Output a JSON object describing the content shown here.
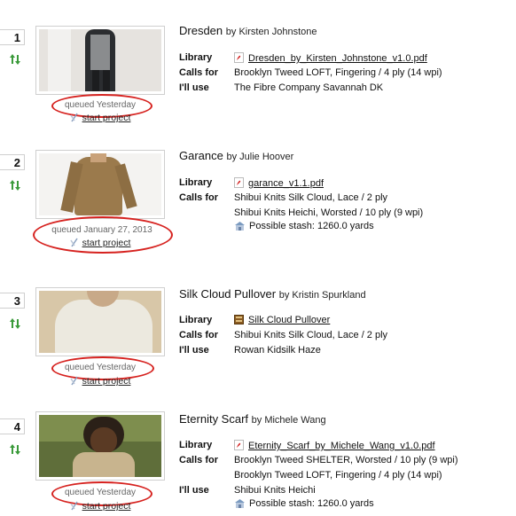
{
  "entries": [
    {
      "rank": "1",
      "title": "Dresden",
      "by": "by Kirsten Johnstone",
      "queued": "queued Yesterday",
      "start_label": "start project",
      "library_label": "Library",
      "library_value": "Dresden_by_Kirsten_Johnstone_v1.0.pdf",
      "calls_for_label": "Calls for",
      "calls_for": [
        "Brooklyn Tweed LOFT, Fingering / 4 ply (14 wpi)"
      ],
      "ill_use_label": "I'll use",
      "ill_use": "The Fibre Company Savannah DK"
    },
    {
      "rank": "2",
      "title": "Garance",
      "by": "by Julie Hoover",
      "queued": "queued January 27, 2013",
      "start_label": "start project",
      "library_label": "Library",
      "library_value": "garance_v1.1.pdf",
      "calls_for_label": "Calls for",
      "calls_for": [
        "Shibui Knits Silk Cloud, Lace / 2 ply",
        "Shibui Knits Heichi, Worsted / 10 ply (9 wpi)"
      ],
      "stash": "Possible stash: 1260.0 yards"
    },
    {
      "rank": "3",
      "title": "Silk Cloud Pullover",
      "by": "by Kristin Spurkland",
      "queued": "queued Yesterday",
      "start_label": "start project",
      "library_label": "Library",
      "library_value": "Silk Cloud Pullover",
      "calls_for_label": "Calls for",
      "calls_for": [
        "Shibui Knits Silk Cloud, Lace / 2 ply"
      ],
      "ill_use_label": "I'll use",
      "ill_use": "Rowan Kidsilk Haze"
    },
    {
      "rank": "4",
      "title": "Eternity Scarf",
      "by": "by Michele Wang",
      "queued": "queued Yesterday",
      "start_label": "start project",
      "library_label": "Library",
      "library_value": "Eternity_Scarf_by_Michele_Wang_v1.0.pdf",
      "calls_for_label": "Calls for",
      "calls_for": [
        "Brooklyn Tweed SHELTER, Worsted / 10 ply (9 wpi)",
        "Brooklyn Tweed LOFT, Fingering / 4 ply (14 wpi)"
      ],
      "ill_use_label": "I'll use",
      "ill_use": "Shibui Knits Heichi",
      "stash": "Possible stash: 1260.0 yards"
    }
  ],
  "colors": {
    "highlight_oval": "#d6221f",
    "reorder_arrows": "#3a9a3a"
  },
  "icons": {
    "reorder": "green-arrows-icon",
    "start": "yarn-needle-icon",
    "pdf": "pdf-icon",
    "book": "book-icon",
    "stash": "stash-icon"
  }
}
